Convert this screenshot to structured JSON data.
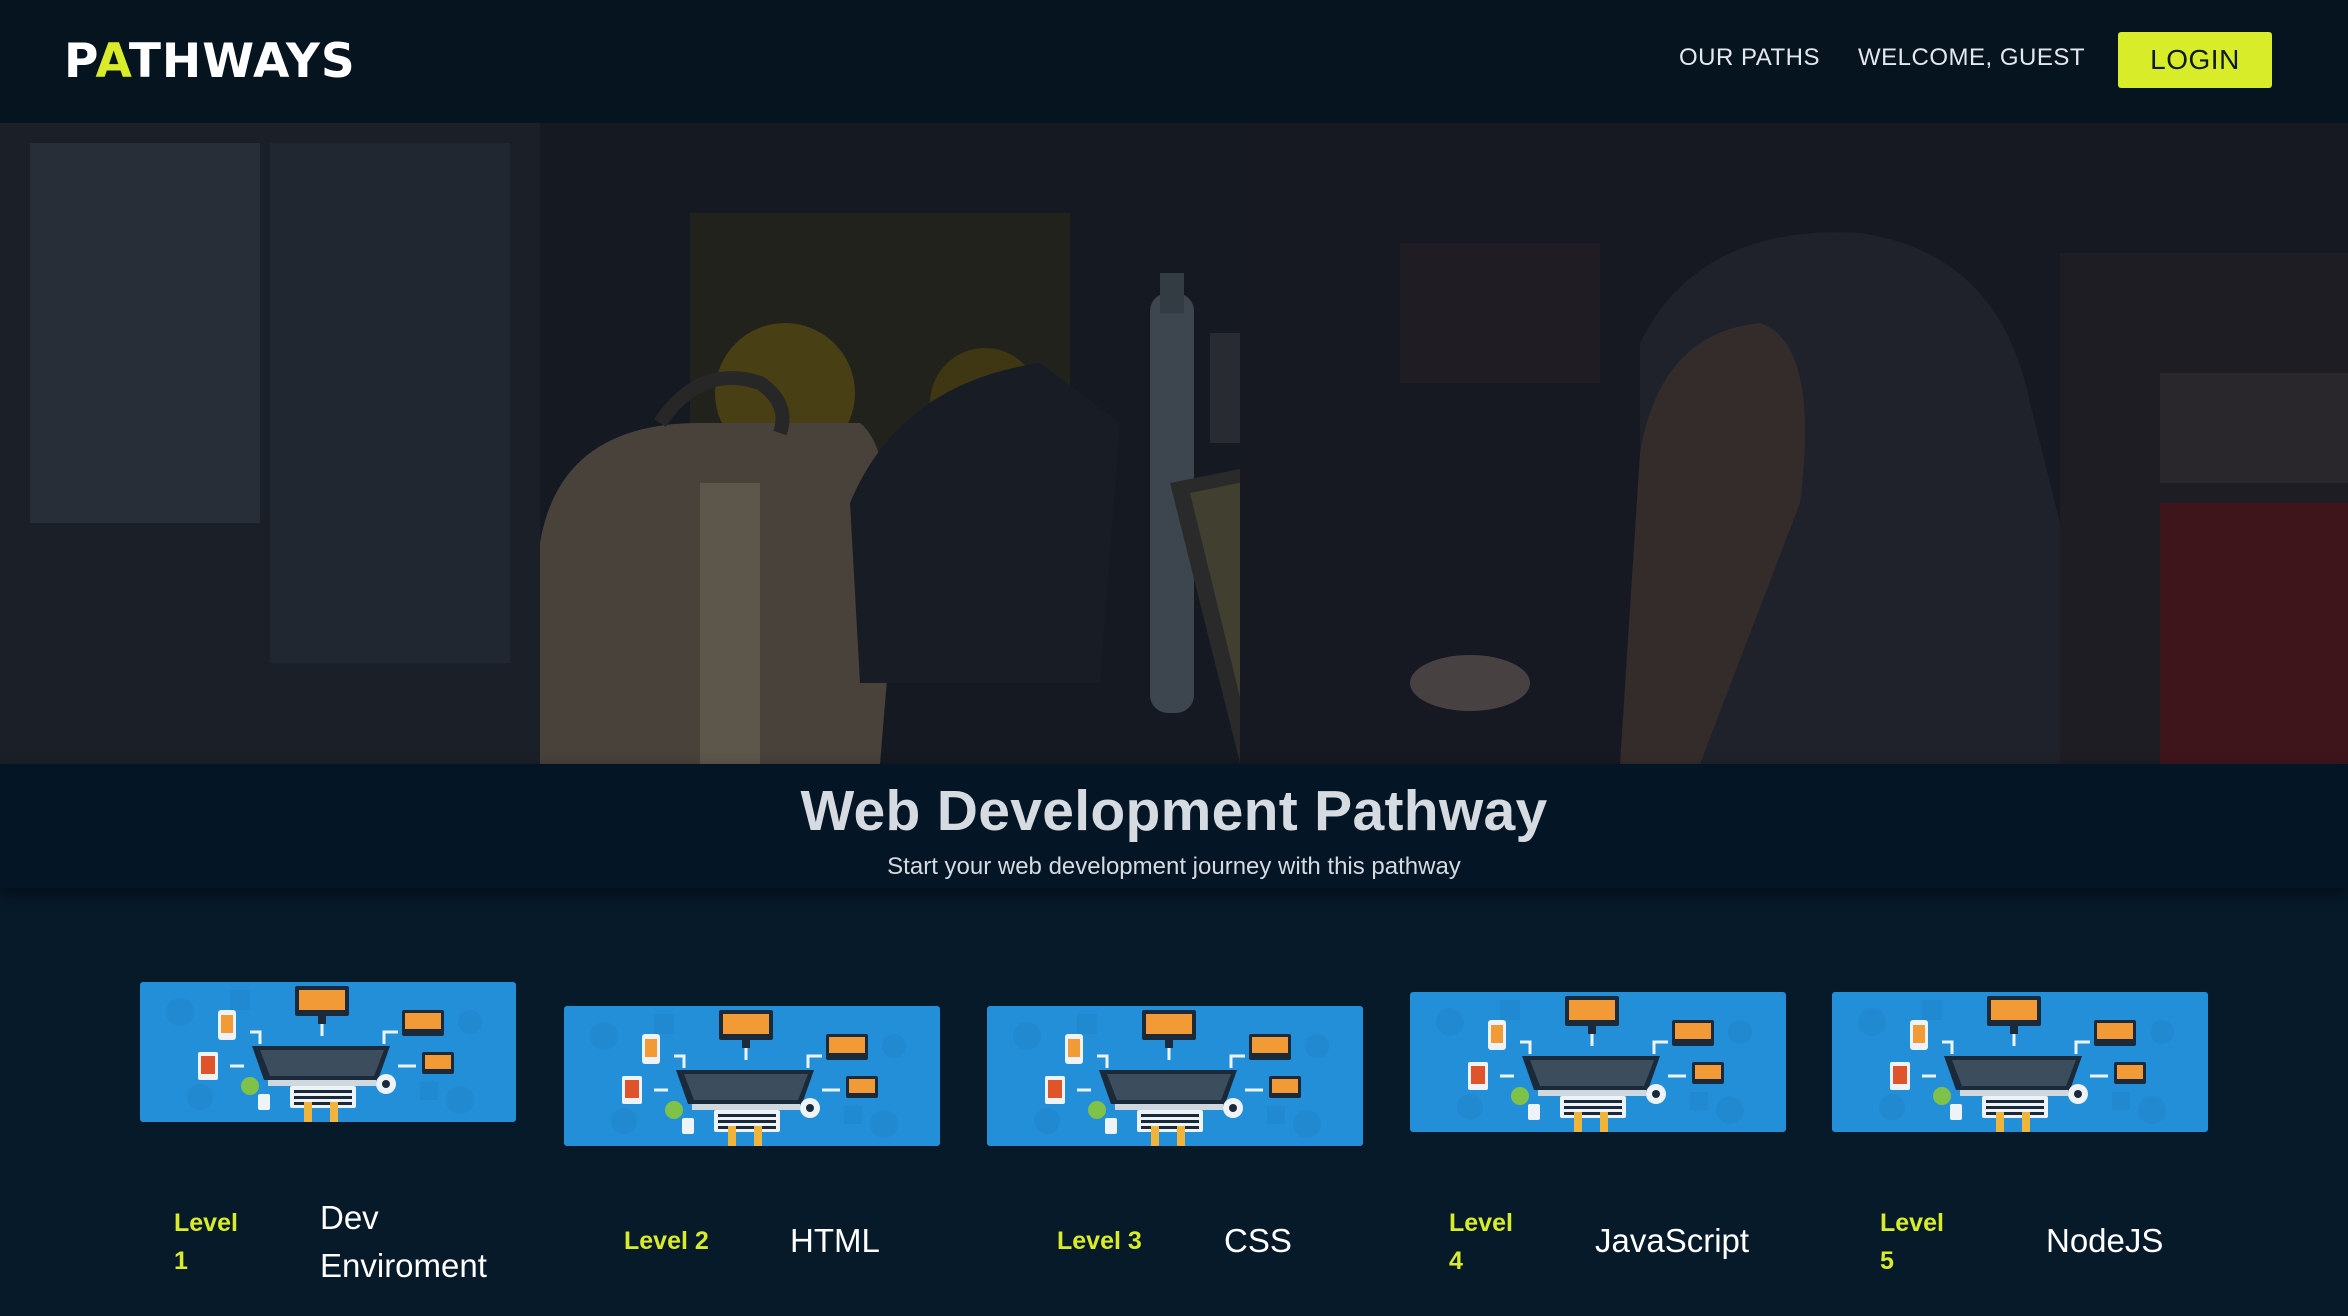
{
  "header": {
    "logo_text_prefix": "P",
    "logo_text_mark": "A",
    "logo_text_suffix": "THWAYS",
    "nav_paths": "OUR PATHS",
    "nav_welcome": "WELCOME, GUEST",
    "login_label": "LOGIN"
  },
  "pathway": {
    "title": "Web Development Pathway",
    "subtitle": "Start your web development journey with this pathway"
  },
  "levels": [
    {
      "label_line1": "Level",
      "label_line2": "1",
      "name_line1": "Dev",
      "name_line2": "Enviroment"
    },
    {
      "label": "Level 2",
      "name": "HTML"
    },
    {
      "label": "Level 3",
      "name": "CSS"
    },
    {
      "label_line1": "Level",
      "label_line2": "4",
      "name": "JavaScript"
    },
    {
      "label_line1": "Level",
      "label_line2": "5",
      "name": "NodeJS"
    }
  ],
  "colors": {
    "accent": "#d9ec2a",
    "background": "#071a2a",
    "header": "#061420",
    "card": "#238fd8"
  }
}
